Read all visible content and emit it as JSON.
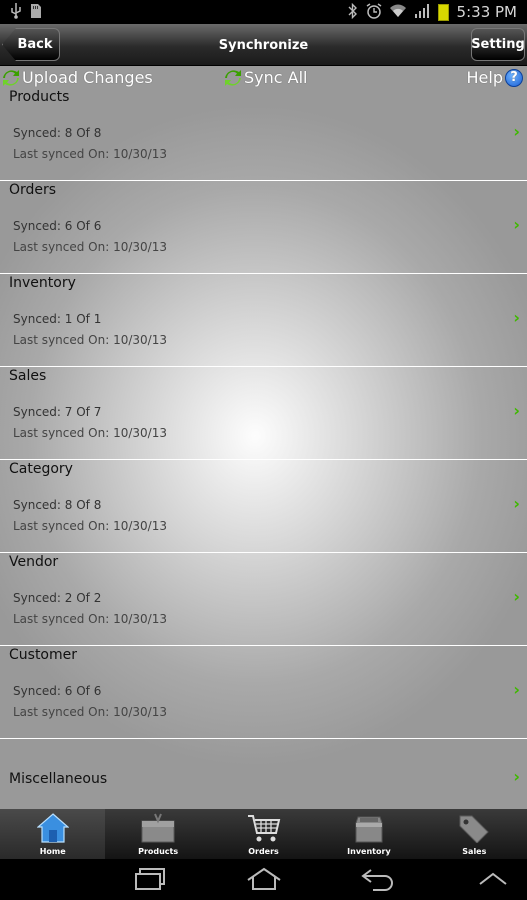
{
  "status_bar": {
    "time": "5:33 PM",
    "left_icons": [
      "usb-icon",
      "sd-card-icon"
    ],
    "right_icons": [
      "bluetooth-icon",
      "alarm-icon",
      "wifi-icon",
      "signal-icon",
      "battery-icon"
    ]
  },
  "header": {
    "back_label": "Back",
    "title": "Synchronize",
    "setting_label": "Setting"
  },
  "toolbar": {
    "upload_label": "Upload Changes",
    "sync_all_label": "Sync All",
    "help_label": "Help",
    "help_icon_glyph": "?"
  },
  "sync_items": [
    {
      "title": "Products",
      "synced": "Synced: 8 Of 8",
      "last": "Last synced On: 10/30/13"
    },
    {
      "title": "Orders",
      "synced": "Synced: 6 Of 6",
      "last": "Last synced On: 10/30/13"
    },
    {
      "title": "Inventory",
      "synced": "Synced: 1 Of 1",
      "last": "Last synced On: 10/30/13"
    },
    {
      "title": "Sales",
      "synced": "Synced: 7 Of 7",
      "last": "Last synced On: 10/30/13"
    },
    {
      "title": "Category",
      "synced": "Synced: 8 Of 8",
      "last": "Last synced On: 10/30/13"
    },
    {
      "title": "Vendor",
      "synced": "Synced: 2 Of 2",
      "last": "Last synced On: 10/30/13"
    },
    {
      "title": "Customer",
      "synced": "Synced: 6 Of 6",
      "last": "Last synced On: 10/30/13"
    }
  ],
  "misc": {
    "title": "Miscellaneous"
  },
  "chevron_glyph": "›",
  "tabs": [
    {
      "label": "Home",
      "icon": "home-icon",
      "active": true
    },
    {
      "label": "Products",
      "icon": "box-icon",
      "active": false
    },
    {
      "label": "Orders",
      "icon": "cart-icon",
      "active": false
    },
    {
      "label": "Inventory",
      "icon": "inventory-icon",
      "active": false
    },
    {
      "label": "Sales",
      "icon": "tag-icon",
      "active": false
    }
  ],
  "colors": {
    "accent_green": "#3fb800",
    "help_blue": "#1b5fd3"
  }
}
